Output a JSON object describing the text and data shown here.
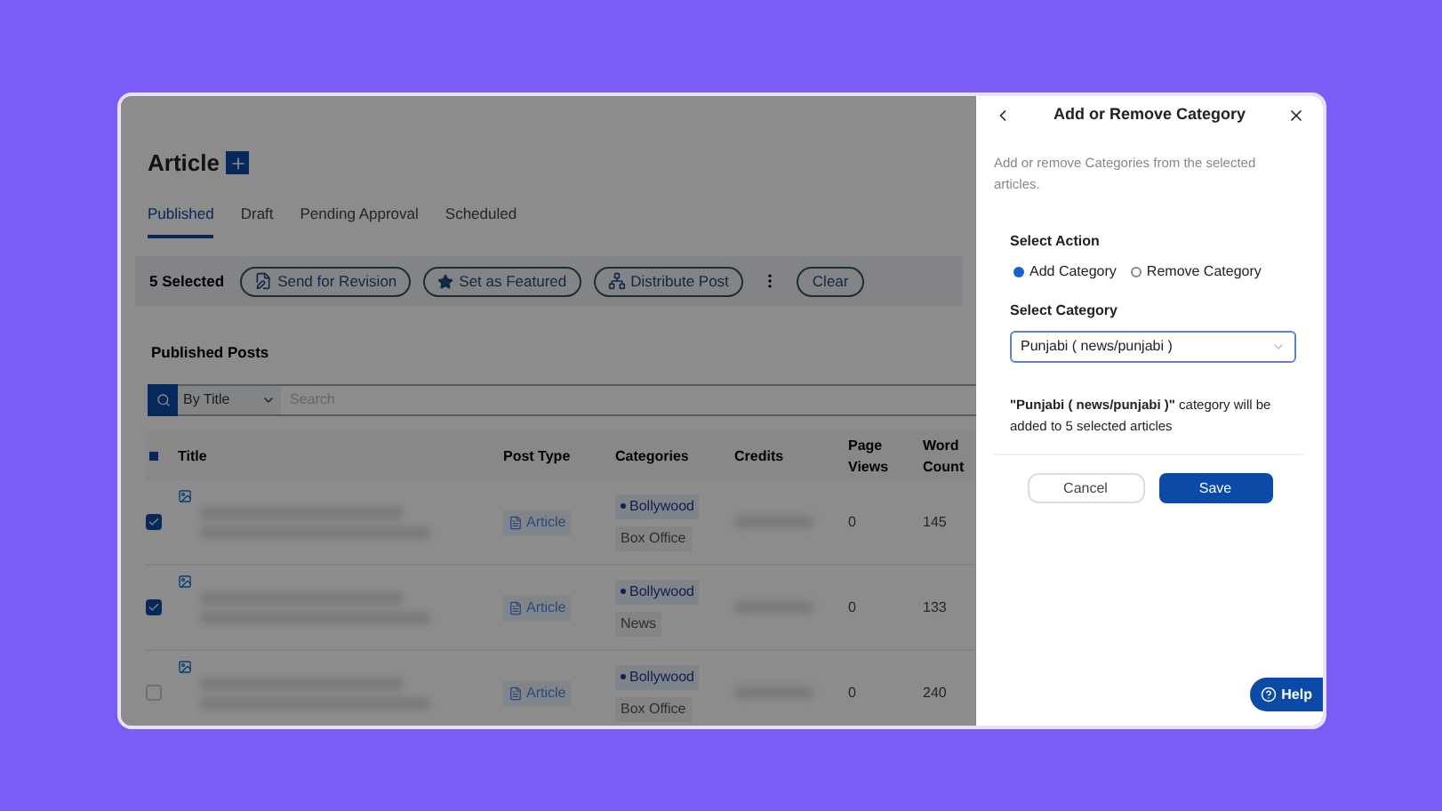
{
  "page": {
    "title": "Article",
    "tabs": [
      {
        "label": "Published",
        "selected": true
      },
      {
        "label": "Draft",
        "selected": false
      },
      {
        "label": "Pending Approval",
        "selected": false
      },
      {
        "label": "Scheduled",
        "selected": false
      }
    ],
    "selection": {
      "count": "5 Selected",
      "actions": [
        {
          "kind": "revision",
          "label": "Send for Revision"
        },
        {
          "kind": "featured",
          "label": "Set as Featured"
        },
        {
          "kind": "distribute",
          "label": "Distribute Post"
        }
      ],
      "clear": "Clear"
    },
    "section_title": "Published Posts",
    "search": {
      "filter": "By Title",
      "placeholder": "Search"
    },
    "table": {
      "columns": [
        "Title",
        "Post Type",
        "Categories",
        "Credits",
        "Page Views",
        "Word Count"
      ],
      "rows": [
        {
          "checked": true,
          "post_type": "Article",
          "category": "Bollywood",
          "subcategory": "Box Office",
          "page_views": "0",
          "word_count": "145"
        },
        {
          "checked": true,
          "post_type": "Article",
          "category": "Bollywood",
          "subcategory": "News",
          "page_views": "0",
          "word_count": "133"
        },
        {
          "checked": false,
          "post_type": "Article",
          "category": "Bollywood",
          "subcategory": "Box Office",
          "page_views": "0",
          "word_count": "240"
        }
      ]
    }
  },
  "panel": {
    "title": "Add or Remove Category",
    "description": "Add or remove Categories from the selected articles.",
    "action_label": "Select Action",
    "actions": [
      {
        "label": "Add Category",
        "selected": true
      },
      {
        "label": "Remove Category",
        "selected": false
      }
    ],
    "category_label": "Select Category",
    "category_value": "Punjabi ( news/punjabi )",
    "summary": "**\"Punjabi ( news/punjabi )\"** category will be added to 5 selected articles",
    "buttons": [
      {
        "kind": "secondary",
        "label": "Cancel"
      },
      {
        "kind": "primary",
        "label": "Save"
      }
    ],
    "help": "Help"
  }
}
